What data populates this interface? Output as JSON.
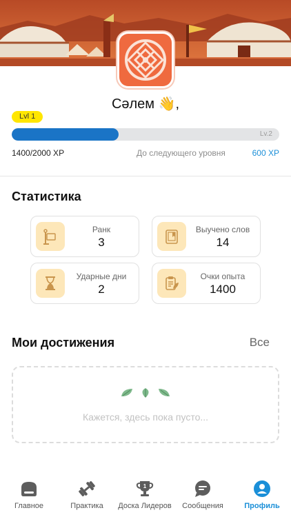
{
  "profile": {
    "greeting": "Сәлем 👋,",
    "level_badge": "Lvl 1",
    "next_level_tag": "Lv.2",
    "xp_current": "1400/2000 XP",
    "xp_next_label": "До следующего уровня",
    "xp_remaining": "600 XP",
    "progress_fraction": 0.4,
    "accent_color": "#1a74c6",
    "avatar_icon": "ornament-icon"
  },
  "stats": {
    "title": "Статистика",
    "items": [
      {
        "label": "Ранк",
        "value": "3",
        "icon": "flag-icon"
      },
      {
        "label": "Выучено слов",
        "value": "14",
        "icon": "book-icon"
      },
      {
        "label": "Ударные дни",
        "value": "2",
        "icon": "hourglass-icon"
      },
      {
        "label": "Очки опыта",
        "value": "1400",
        "icon": "clipboard-leaf-icon"
      }
    ]
  },
  "achievements": {
    "title": "Мои достижения",
    "all_link": "Все",
    "empty_text": "Кажется, здесь пока пусто..."
  },
  "tabbar": {
    "items": [
      {
        "label": "Главное",
        "icon": "home-icon"
      },
      {
        "label": "Практика",
        "icon": "dumbbell-icon"
      },
      {
        "label": "Доска Лидеров",
        "icon": "trophy-icon"
      },
      {
        "label": "Сообщения",
        "icon": "chat-icon"
      },
      {
        "label": "Профиль",
        "icon": "profile-icon",
        "active": true
      }
    ]
  }
}
